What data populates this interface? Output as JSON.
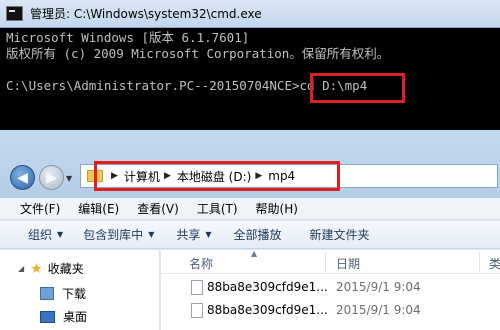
{
  "cmd": {
    "title": "管理员: C:\\Windows\\system32\\cmd.exe",
    "lines": [
      "Microsoft Windows [版本 6.1.7601]",
      "版权所有 (c) 2009 Microsoft Corporation。保留所有权利。"
    ],
    "prompt": "C:\\Users\\Administrator.PC--20150704NCE>",
    "command": "cd D:\\mp4"
  },
  "explorer": {
    "breadcrumb": [
      "计算机",
      "本地磁盘 (D:)",
      "mp4"
    ],
    "menu": [
      "文件(F)",
      "编辑(E)",
      "查看(V)",
      "工具(T)",
      "帮助(H)"
    ],
    "toolbar": {
      "organize": "组织",
      "include": "包含到库中",
      "share": "共享",
      "play_all": "全部播放",
      "new_folder": "新建文件夹"
    },
    "nav": {
      "favorites": "收藏夹",
      "downloads": "下载",
      "desktop": "桌面"
    },
    "columns": {
      "name": "名称",
      "date": "日期",
      "more": "类"
    },
    "files": [
      {
        "name": "88ba8e309cfd9e1...",
        "date": "2015/9/1 9:04"
      },
      {
        "name": "88ba8e309cfd9e1...",
        "date": "2015/9/1 9:04"
      }
    ]
  }
}
